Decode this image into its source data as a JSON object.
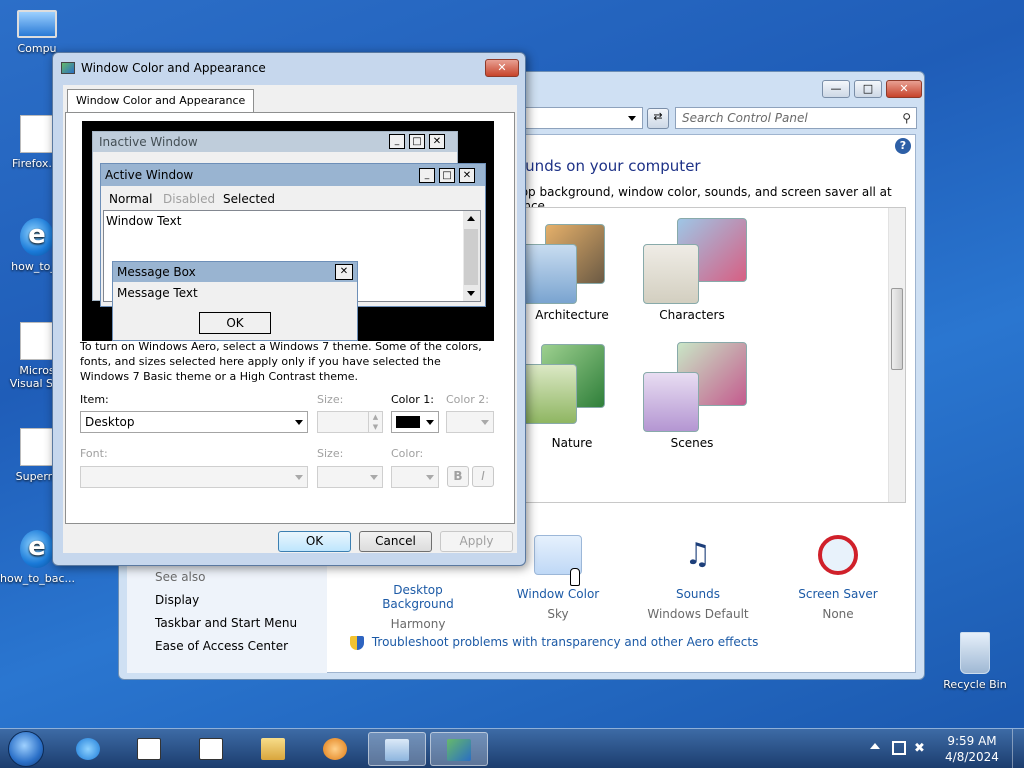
{
  "desktop": {
    "icons": [
      {
        "label": "Compu"
      },
      {
        "label": "Firefox.in"
      },
      {
        "label": "how_to_b"
      },
      {
        "label": "Micros"
      },
      {
        "label": "Visual Stu"
      },
      {
        "label": "Superm"
      },
      {
        "label": "how_to_bac..."
      },
      {
        "label": "Recycle Bin"
      }
    ]
  },
  "control_panel": {
    "search_placeholder": "Search Control Panel",
    "heading": "ounds on your computer",
    "subheading": "top background, window color, sounds, and screen saver all at once.",
    "themes": [
      {
        "label": "Architecture"
      },
      {
        "label": "Characters"
      },
      {
        "label": "Nature"
      },
      {
        "label": "Scenes"
      }
    ],
    "see_also": "See also",
    "left_links": [
      "Display",
      "Taskbar and Start Menu",
      "Ease of Access Center"
    ],
    "bottom_items": [
      {
        "title": "Desktop Background",
        "value": "Harmony"
      },
      {
        "title": "Window Color",
        "value": "Sky"
      },
      {
        "title": "Sounds",
        "value": "Windows Default"
      },
      {
        "title": "Screen Saver",
        "value": "None"
      }
    ],
    "troubleshoot": "Troubleshoot problems with transparency and other Aero effects"
  },
  "dialog": {
    "title": "Window Color and Appearance",
    "tab": "Window Color and Appearance",
    "preview": {
      "inactive_window": "Inactive Window",
      "active_window": "Active Window",
      "menu_normal": "Normal",
      "menu_disabled": "Disabled",
      "menu_selected": "Selected",
      "window_text": "Window Text",
      "message_box": "Message Box",
      "message_text": "Message Text",
      "ok": "OK"
    },
    "info": "To turn on Windows Aero, select a Windows 7 theme.  Some of the colors, fonts, and sizes selected here apply only if you have selected the Windows 7 Basic theme or a High Contrast theme.",
    "item_label": "Item:",
    "item_value": "Desktop",
    "size_label": "Size:",
    "color1_label": "Color 1:",
    "color1_value": "#000000",
    "color2_label": "Color 2:",
    "font_label": "Font:",
    "font_size_label": "Size:",
    "font_color_label": "Color:",
    "bold_label": "B",
    "italic_label": "I",
    "ok": "OK",
    "cancel": "Cancel",
    "apply": "Apply"
  },
  "taskbar": {
    "clock_time": "9:59 AM",
    "clock_date": "4/8/2024"
  }
}
